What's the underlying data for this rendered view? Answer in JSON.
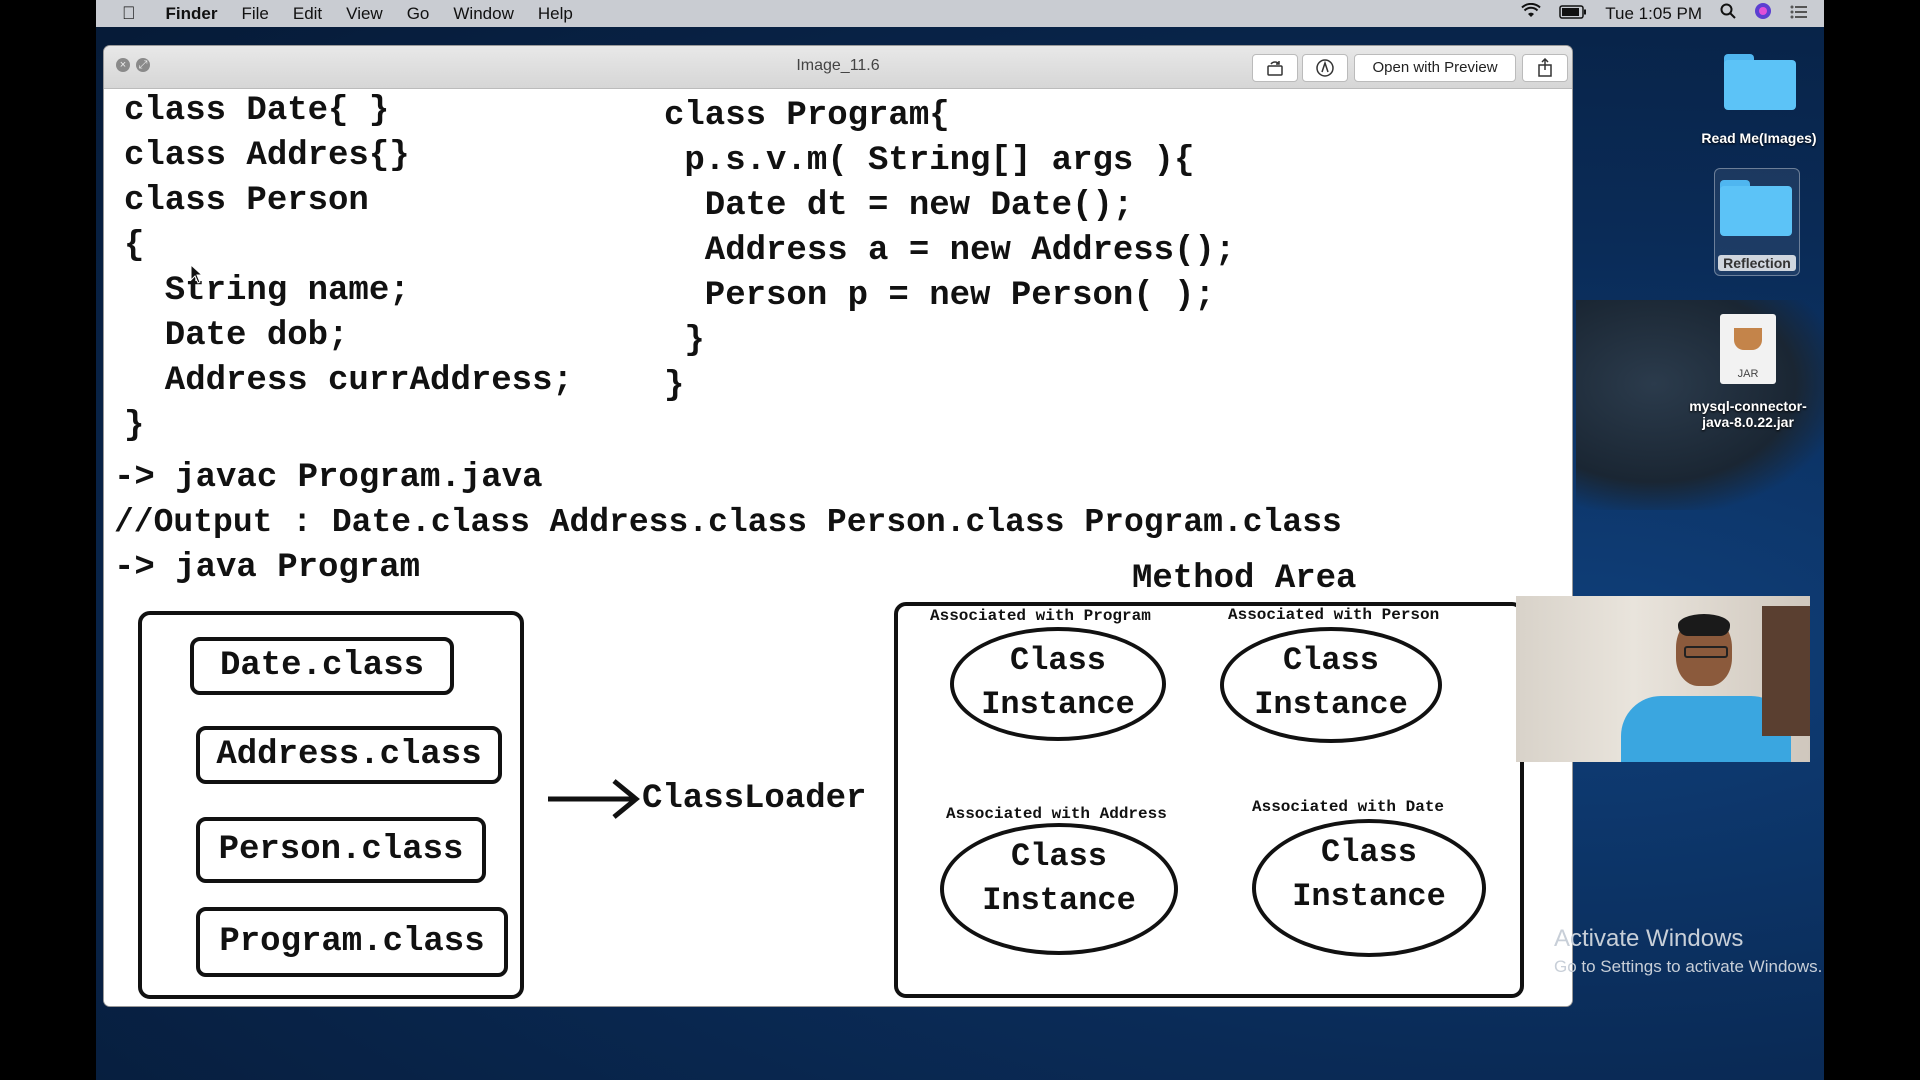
{
  "menubar": {
    "app": "Finder",
    "items": [
      "File",
      "Edit",
      "View",
      "Go",
      "Window",
      "Help"
    ],
    "clock": "Tue 1:05 PM"
  },
  "window": {
    "title": "Image_11.6",
    "open_with_preview": "Open with Preview"
  },
  "code_left": [
    "class Date{ }",
    "class Addres{}",
    "class Person",
    "{",
    "  String name;",
    "  Date dob;",
    "  Address currAddress;",
    "}"
  ],
  "code_right": [
    "class Program{",
    " p.s.v.m( String[] args ){",
    "  Date dt = new Date();",
    "  Address a = new Address();",
    "  Person p = new Person( );",
    " }",
    "}"
  ],
  "commands": [
    "-> javac Program.java",
    "//Output : Date.class Address.class Person.class Program.class",
    "-> java Program"
  ],
  "diagram": {
    "class_files": [
      "Date.class",
      "Address.class",
      "Person.class",
      "Program.class"
    ],
    "classloader": "ClassLoader",
    "method_area": "Method Area",
    "assoc": {
      "program": "Associated with Program",
      "person": "Associated with Person",
      "address": "Associated with Address",
      "date": "Associated with Date"
    },
    "class_word": "Class",
    "instance_word": "Instance"
  },
  "desktop": {
    "icons": [
      {
        "label": "Read Me(Images)",
        "type": "folder-icon"
      },
      {
        "label": "Reflection",
        "type": "folder-icon"
      },
      {
        "label": "mysql-connector-java-8.0.22.jar",
        "type": "jar-icon"
      }
    ],
    "jar_badge": "JAR"
  },
  "watermark": {
    "line1": "Activate Windows",
    "line2": "Go to Settings to activate Windows."
  }
}
